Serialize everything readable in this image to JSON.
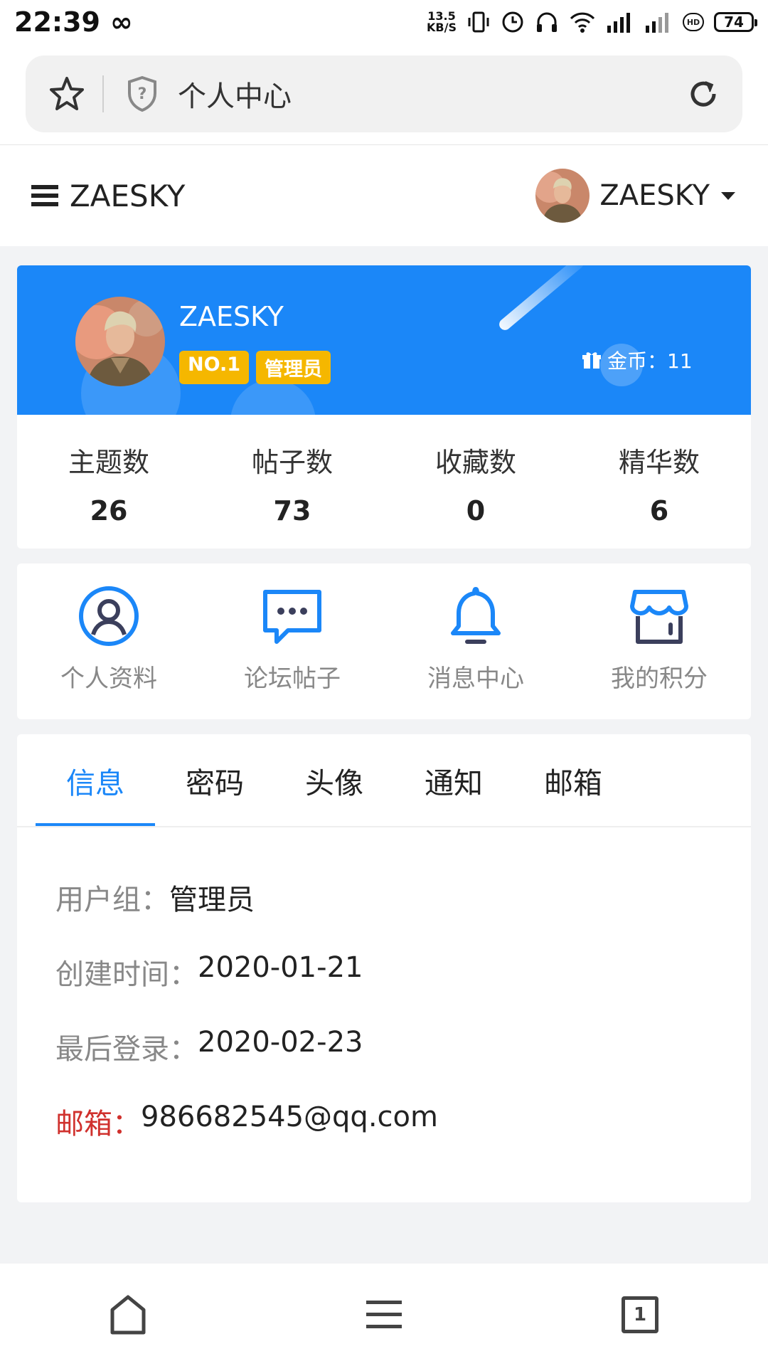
{
  "status_bar": {
    "time": "22:39",
    "infinity": "∞",
    "net_speed_top": "13.5",
    "net_speed_bottom": "KB/S",
    "hd": "HD",
    "battery": "74"
  },
  "browser": {
    "page_title": "个人中心",
    "icons": [
      "star-icon",
      "shield-icon",
      "refresh-icon"
    ]
  },
  "header": {
    "brand": "ZAESKY",
    "username": "ZAESKY"
  },
  "profile": {
    "name": "ZAESKY",
    "badges": [
      "NO.1",
      "管理员"
    ],
    "coins_label": "金币：11",
    "banner_color": "#1b87f8"
  },
  "stats": [
    {
      "label": "主题数",
      "value": "26"
    },
    {
      "label": "帖子数",
      "value": "73"
    },
    {
      "label": "收藏数",
      "value": "0"
    },
    {
      "label": "精华数",
      "value": "6"
    }
  ],
  "actions": [
    {
      "label": "个人资料",
      "icon": "user-circle-icon"
    },
    {
      "label": "论坛帖子",
      "icon": "chat-bubble-icon"
    },
    {
      "label": "消息中心",
      "icon": "bell-icon"
    },
    {
      "label": "我的积分",
      "icon": "store-icon"
    }
  ],
  "tabs": [
    {
      "label": "信息",
      "active": true
    },
    {
      "label": "密码",
      "active": false
    },
    {
      "label": "头像",
      "active": false
    },
    {
      "label": "通知",
      "active": false
    },
    {
      "label": "邮箱",
      "active": false
    }
  ],
  "info": {
    "group_label": "用户组：",
    "group_value": "管理员",
    "created_label": "创建时间：",
    "created_value": "2020-01-21",
    "last_login_label": "最后登录：",
    "last_login_value": "2020-02-23",
    "email_label": "邮箱：",
    "email_value": "986682545@qq.com"
  },
  "bottom_nav": {
    "tab_count": "1",
    "icons": [
      "home-icon",
      "menu-icon",
      "tabs-icon"
    ]
  },
  "colors": {
    "accent": "#1b87f8",
    "badge": "#f5b700",
    "email_label": "#d0312d"
  }
}
